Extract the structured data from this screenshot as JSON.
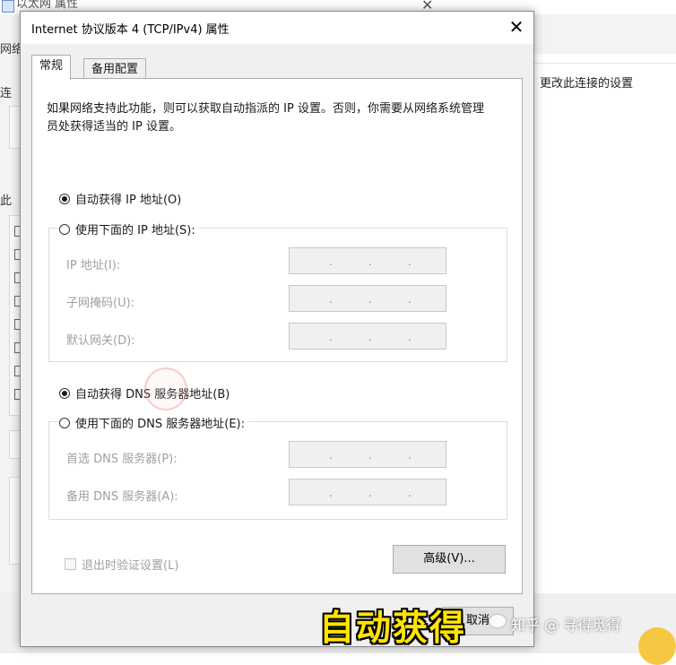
{
  "background": {
    "window_title": "以太网 属性",
    "edge_texts": [
      "网络",
      "连",
      "此"
    ],
    "right_link": "更改此连接的设置"
  },
  "dialog": {
    "title": "Internet 协议版本 4 (TCP/IPv4) 属性",
    "close_glyph": "✕",
    "tabs": [
      {
        "label": "常规",
        "active": true
      },
      {
        "label": "备用配置",
        "active": false
      }
    ],
    "description": "如果网络支持此功能，则可以获取自动指派的 IP 设置。否则，你需要从网络系统管理员处获得适当的 IP 设置。",
    "ip": {
      "auto_label": "自动获得 IP 地址(O)",
      "auto_selected": true,
      "manual_label": "使用下面的 IP 地址(S):",
      "manual_selected": false,
      "fields": [
        {
          "label": "IP 地址(I):",
          "value": ". . ."
        },
        {
          "label": "子网掩码(U):",
          "value": ". . ."
        },
        {
          "label": "默认网关(D):",
          "value": ". . ."
        }
      ]
    },
    "dns": {
      "auto_label": "自动获得 DNS 服务器地址(B)",
      "auto_selected": true,
      "manual_label": "使用下面的 DNS 服务器地址(E):",
      "manual_selected": false,
      "fields": [
        {
          "label": "首选 DNS 服务器(P):",
          "value": ". . ."
        },
        {
          "label": "备用 DNS 服务器(A):",
          "value": ". . ."
        }
      ]
    },
    "validate_label": "退出时验证设置(L)",
    "validate_checked": false,
    "advanced_button": "高级(V)...",
    "cancel_button": "取消"
  },
  "overlay": {
    "caption": "自动获得",
    "watermark": "知乎 @ 寻得觅得"
  },
  "colors": {
    "caption": "#ffe400",
    "dialog_bg": "#f0f0f0",
    "disabled_text": "#a0a0a0"
  }
}
